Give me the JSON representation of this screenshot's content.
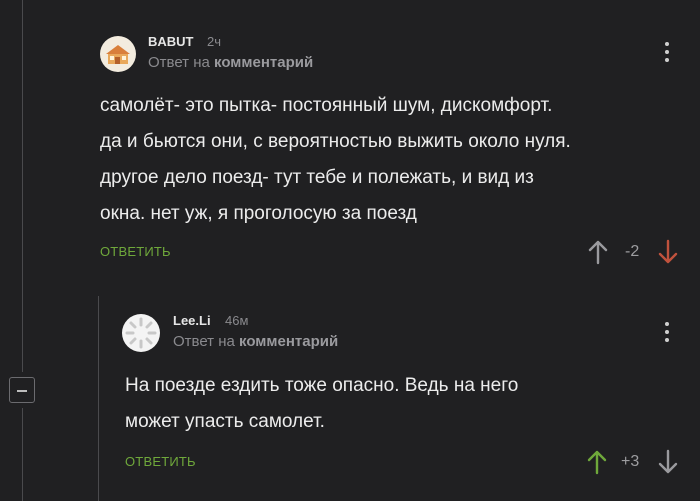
{
  "comments": [
    {
      "username": "BABUT",
      "time": "2ч",
      "reply_prefix": "Ответ на",
      "reply_target": "комментарий",
      "text_lines": [
        "самолёт- это пытка- постоянный шум, дискомфорт.",
        "да и бьются они, с вероятностью выжить около нуля.",
        "другое дело поезд- тут тебе и полежать, и вид из",
        "окна. нет уж, я проголосую за поезд"
      ],
      "reply_label": "ОТВЕТИТЬ",
      "rating": "-2",
      "active_vote": "down",
      "vote_colors": {
        "up": "#9a9a9e",
        "down": "#c0523d"
      }
    },
    {
      "username": "Lee.Li",
      "time": "46м",
      "reply_prefix": "Ответ на",
      "reply_target": "комментарий",
      "text_lines": [
        "На поезде ездить тоже опасно. Ведь на него",
        "может упасть самолет."
      ],
      "reply_label": "ОТВЕТИТЬ",
      "rating": "+3",
      "active_vote": "up",
      "vote_colors": {
        "up": "#6fa83b",
        "down": "#9a9a9e"
      }
    }
  ],
  "icons": {
    "collapse": "minus-icon",
    "menu": "kebab-menu-icon",
    "upvote": "arrow-up-icon",
    "downvote": "arrow-down-icon"
  }
}
